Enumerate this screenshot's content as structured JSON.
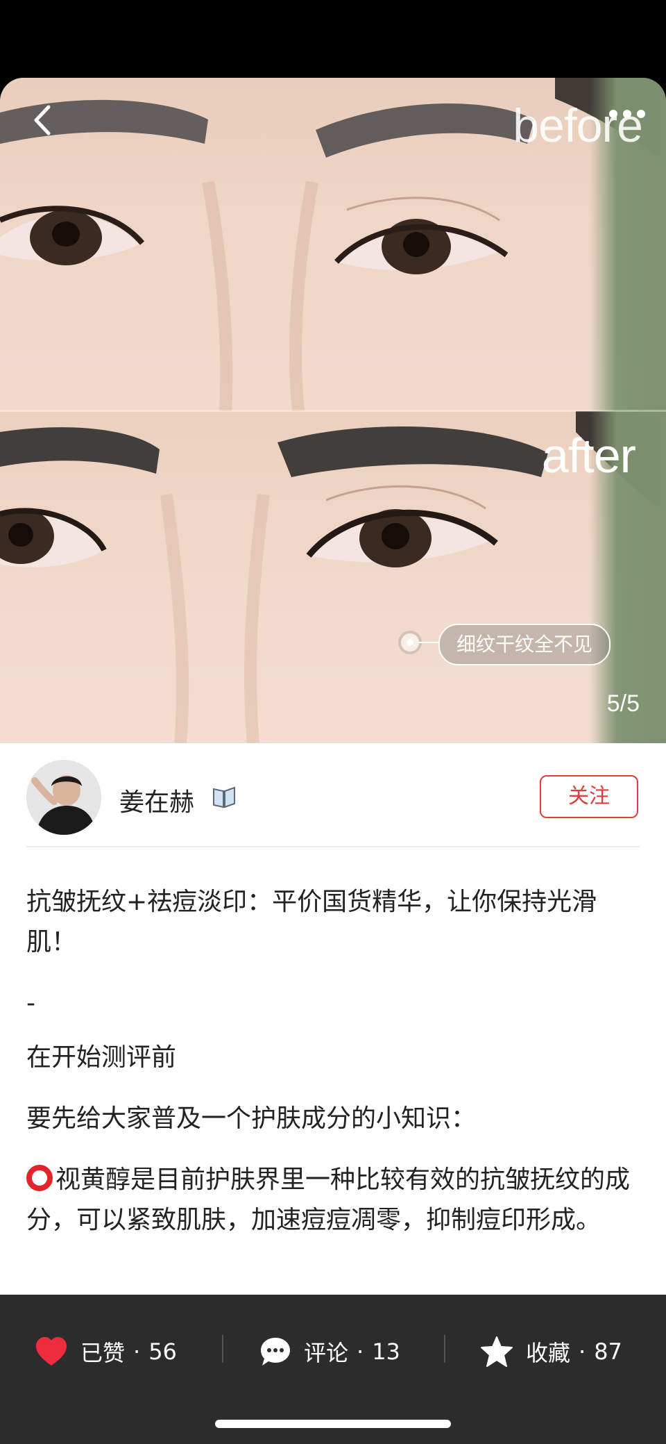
{
  "media": {
    "before_label": "before",
    "after_label": "after",
    "tag_text": "细纹干纹全不见",
    "page_indicator": "5/5"
  },
  "author": {
    "name": "姜在赫",
    "follow_label": "关注"
  },
  "post": {
    "title_line": "抗皱抚纹+祛痘淡印：平价国货精华，让你保持光滑肌！",
    "separator": "-",
    "para1": "在开始测评前",
    "para2": "要先给大家普及一个护肤成分的小知识：",
    "para3": "视黄醇是目前护肤界里一种比较有效的抗皱抚纹的成分，可以紧致肌肤，加速痘痘凋零，抑制痘印形成。"
  },
  "actions": {
    "like_label": "已赞",
    "like_count": "56",
    "comment_label": "评论",
    "comment_count": "13",
    "fav_label": "收藏",
    "fav_count": "87",
    "dot": "·"
  },
  "colors": {
    "accent_red": "#e23b3b",
    "bar_bg": "#2c2c2c"
  }
}
